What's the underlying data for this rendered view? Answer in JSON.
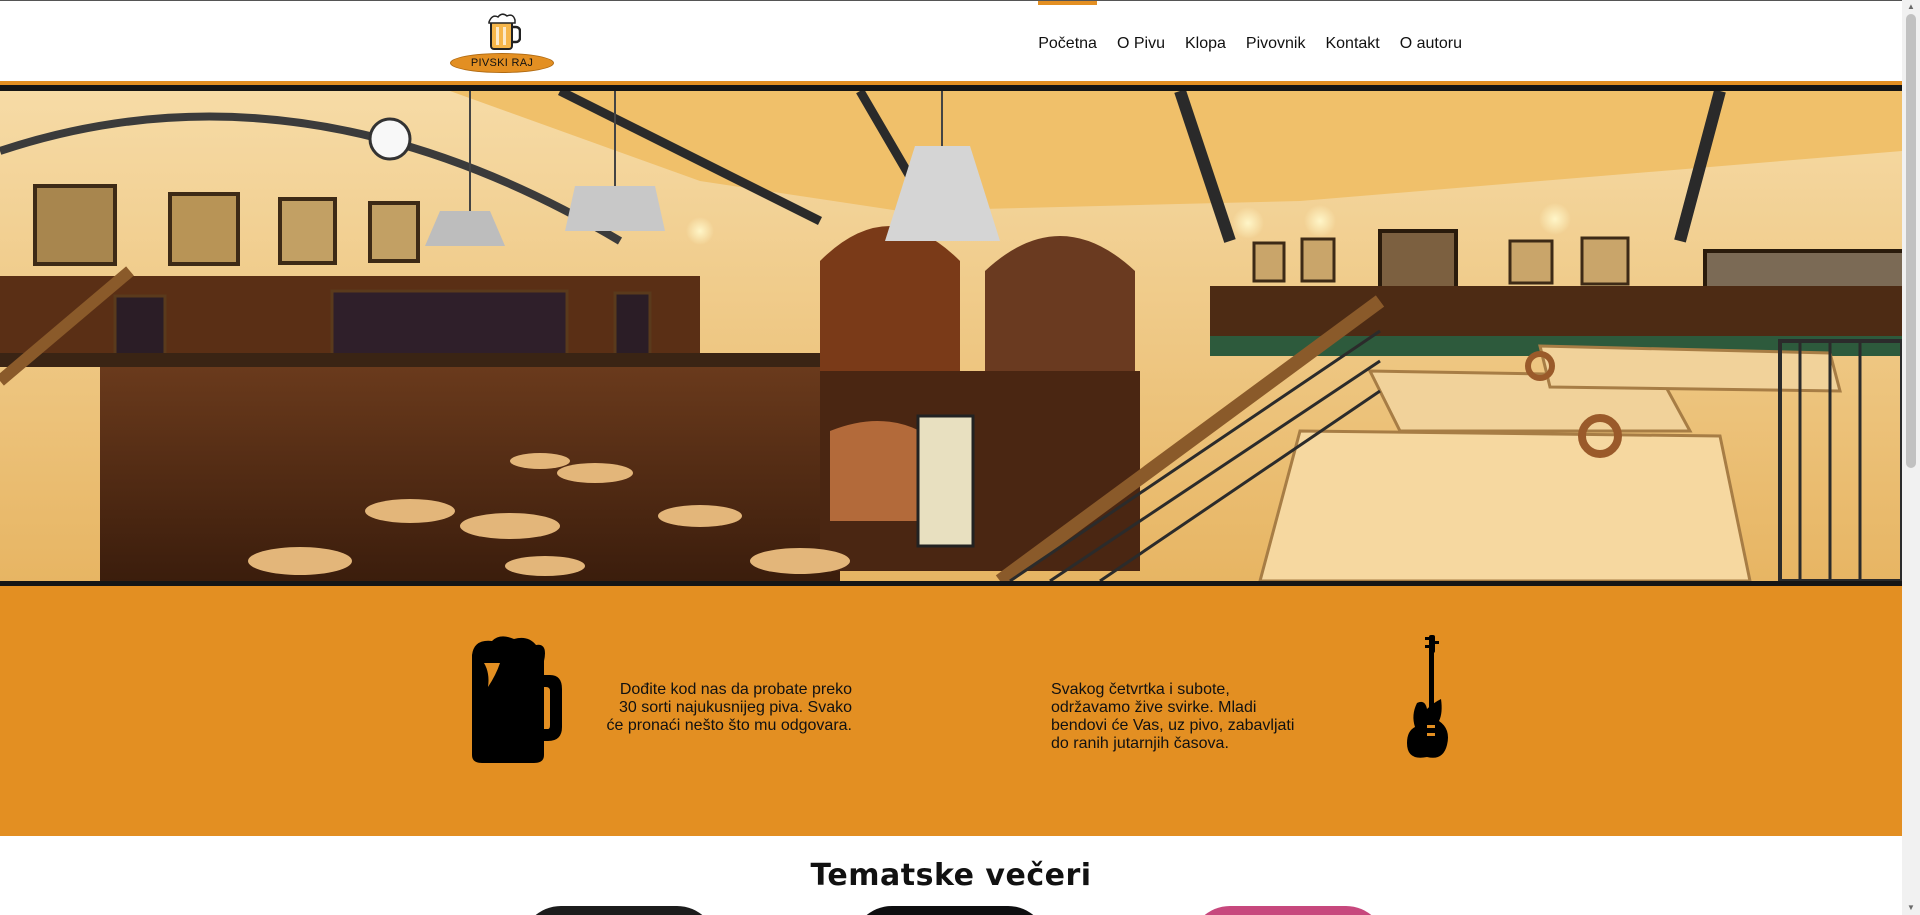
{
  "header": {
    "logo_text": "PIVSKI RAJ",
    "nav": [
      {
        "label": "Početna",
        "active": true
      },
      {
        "label": "O Pivu",
        "active": false
      },
      {
        "label": "Klopa",
        "active": false
      },
      {
        "label": "Pivovnik",
        "active": false
      },
      {
        "label": "Kontakt",
        "active": false
      },
      {
        "label": "O autoru",
        "active": false
      }
    ]
  },
  "features": {
    "beer_text": "Dođite kod nas da probate preko 30 sorti najukusnijeg piva. Svako će pronaći nešto što mu odgovara.",
    "music_text": "Svakog četvrtka i subote, održavamo žive svirke. Mladi bendovi će Vas, uz pivo, zabavljati do ranih jutarnjih časova."
  },
  "section": {
    "title": "Tematske večeri"
  },
  "colors": {
    "accent": "#e38f22",
    "dark": "#151515"
  },
  "icons": [
    "beer-mug-icon",
    "electric-guitar-icon"
  ]
}
